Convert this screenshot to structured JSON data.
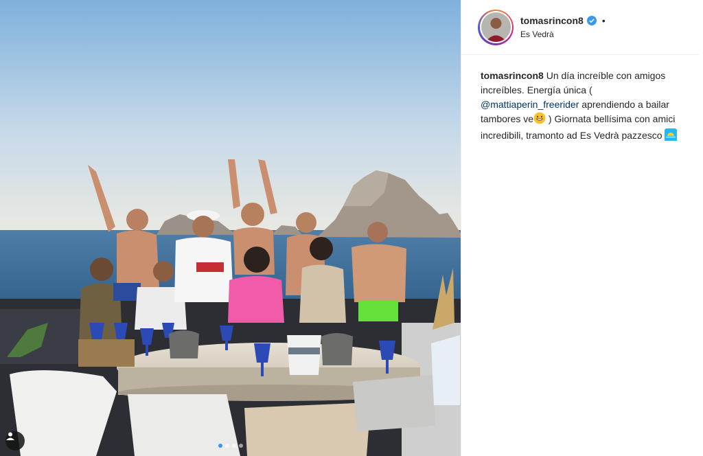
{
  "post": {
    "username": "tomasrincon8",
    "separator": "•",
    "location": "Es Vedrà",
    "caption": {
      "username": "tomasrincon8",
      "text_1": " Un día increíble con amigos increíbles. Energía única ( ",
      "mention": "@mattiaperin_freerider",
      "text_2": " aprendiendo a bailar tambores ve",
      "text_3": " ) Giornata bellísima con amici incredibili, tramonto ad Es Vedrà pazzesco "
    },
    "emojis": [
      "grinning-face-emoji",
      "sunset-emoji"
    ],
    "photo": {
      "description_icon": "group-on-boat-photo",
      "carousel_total": 4,
      "carousel_active": 1
    }
  },
  "colors": {
    "accent": "#3897f0",
    "mention": "#003569",
    "text": "#262626",
    "border": "#efefef"
  }
}
